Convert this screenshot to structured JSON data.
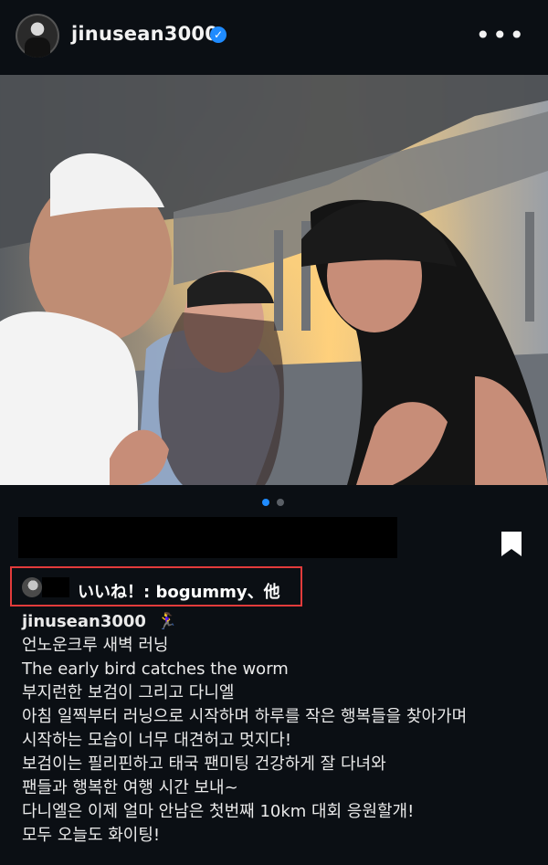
{
  "post": {
    "username": "jinusean3000",
    "verified_icon": "verified-badge-icon",
    "more_icon": "more-options-icon",
    "more_glyph": "•••",
    "pager": {
      "count": 2,
      "active_index": 0
    },
    "likes": {
      "text": "いいね！: bogummy、他"
    },
    "caption": {
      "username": "jinusean3000",
      "emoji": "🏃‍♀️",
      "lines": [
        "언노운크루 새벽 러닝",
        "The early bird catches the worm",
        "부지런한 보검이 그리고 다니엘",
        "아침 일찍부터 러닝으로 시작하며 하루를 작은 행복들을 찾아가며",
        "시작하는 모습이 너무 대견허고 멋지다!",
        "보검이는 필리핀하고 태국 팬미팅 건강하게 잘 다녀와",
        "팬들과 행복한 여행 시간 보내~",
        "다니엘은 이제 얼마 안남은 첫번째 10km 대회 응원할개!",
        "모두 오늘도 화이팅!"
      ]
    }
  },
  "colors": {
    "background": "#0b0f14",
    "accent": "#1f8bff",
    "highlight_border": "#e23b3b"
  }
}
